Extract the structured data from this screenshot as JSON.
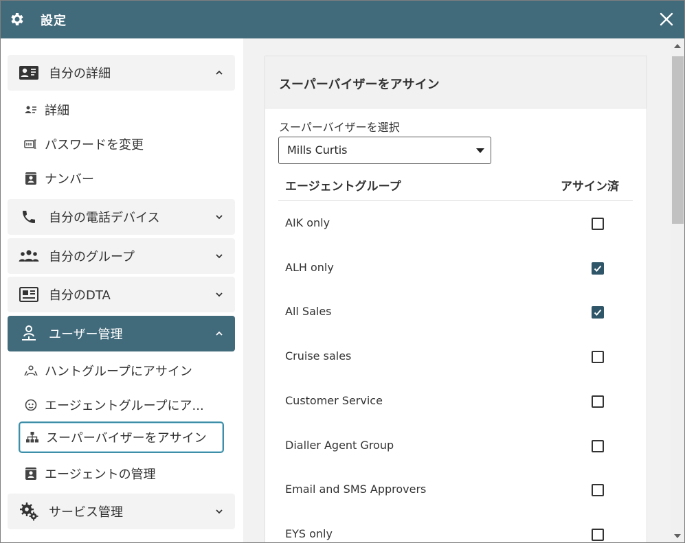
{
  "window": {
    "title": "設定"
  },
  "sidebar": {
    "sections": [
      {
        "label": "自分の詳細",
        "icon": "contact-card-icon",
        "expanded": true
      },
      {
        "label": "自分の電話デバイス",
        "icon": "phone-icon",
        "expanded": false
      },
      {
        "label": "自分のグループ",
        "icon": "group-icon",
        "expanded": false
      },
      {
        "label": "自分のDTA",
        "icon": "dta-icon",
        "expanded": false
      },
      {
        "label": "ユーザー管理",
        "icon": "user-admin-icon",
        "expanded": true,
        "active": true
      },
      {
        "label": "サービス管理",
        "icon": "service-gears-icon",
        "expanded": false
      }
    ],
    "my_details_items": [
      {
        "label": "詳細",
        "icon": "details-icon"
      },
      {
        "label": "パスワードを変更",
        "icon": "password-icon"
      },
      {
        "label": "ナンバー",
        "icon": "number-badge-icon"
      }
    ],
    "user_admin_items": [
      {
        "label": "ハントグループにアサイン",
        "icon": "hunt-group-icon"
      },
      {
        "label": "エージェントグループにア...",
        "icon": "agent-group-icon"
      },
      {
        "label": "スーパーバイザーをアサイン",
        "icon": "hierarchy-icon",
        "selected": true
      },
      {
        "label": "エージェントの管理",
        "icon": "agent-manage-icon"
      }
    ]
  },
  "main": {
    "panel_title": "スーパーバイザーをアサイン",
    "select_label": "スーパーバイザーを選択",
    "select_value": "Mills Curtis",
    "col_group": "エージェントグループ",
    "col_assigned": "アサイン済",
    "rows": [
      {
        "name": "AIK only",
        "checked": false
      },
      {
        "name": "ALH only",
        "checked": true
      },
      {
        "name": "All Sales",
        "checked": true
      },
      {
        "name": "Cruise sales",
        "checked": false
      },
      {
        "name": "Customer Service",
        "checked": false
      },
      {
        "name": "Dialler Agent Group",
        "checked": false
      },
      {
        "name": "Email and SMS Approvers",
        "checked": false
      },
      {
        "name": "EYS only",
        "checked": false
      }
    ]
  },
  "colors": {
    "header_bg": "#416a7b",
    "active_section_bg": "#416a7b",
    "checkbox_checked": "#2f5668",
    "selected_outline": "#3f8ea8"
  }
}
